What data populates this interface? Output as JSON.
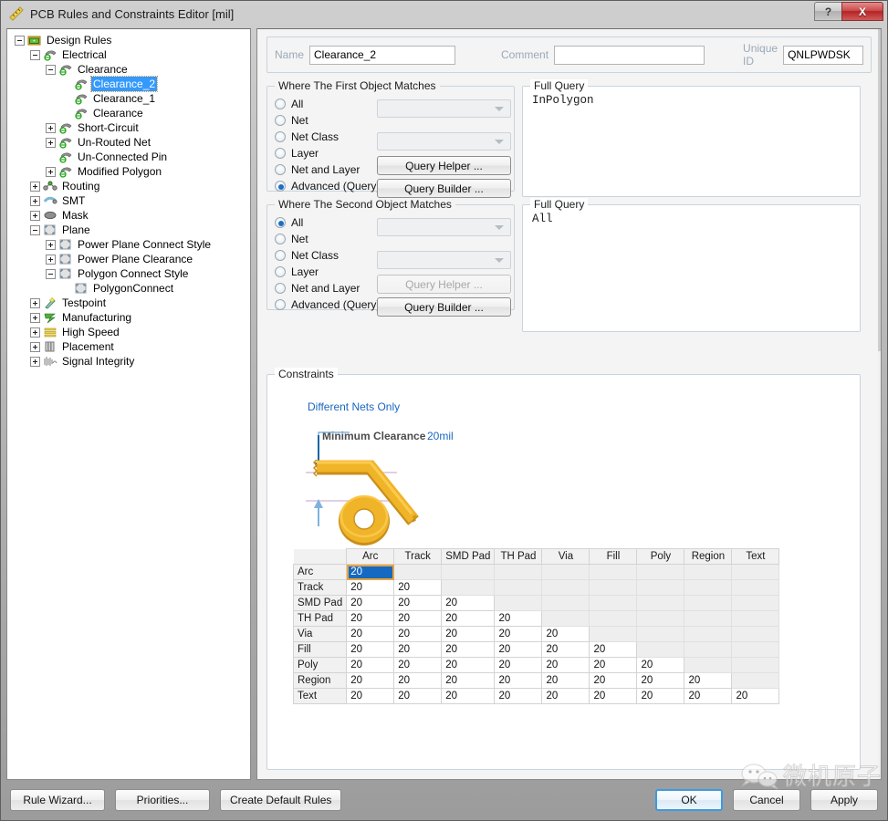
{
  "window": {
    "title": "PCB Rules and Constraints Editor [mil]",
    "app_icon": "ruler-icon",
    "help_button": "?",
    "close_button": "X"
  },
  "tree": {
    "items": [
      {
        "label": "Design Rules",
        "depth": 0,
        "state": "minus",
        "icon": "design-rules-folder-icon",
        "selected": false
      },
      {
        "label": "Electrical",
        "depth": 1,
        "state": "minus",
        "icon": "electrical-icon",
        "selected": false
      },
      {
        "label": "Clearance",
        "depth": 2,
        "state": "minus",
        "icon": "electrical-icon",
        "selected": false
      },
      {
        "label": "Clearance_2",
        "depth": 3,
        "state": "none",
        "icon": "electrical-icon",
        "selected": true
      },
      {
        "label": "Clearance_1",
        "depth": 3,
        "state": "none",
        "icon": "electrical-icon",
        "selected": false
      },
      {
        "label": "Clearance",
        "depth": 3,
        "state": "none",
        "icon": "electrical-icon",
        "selected": false
      },
      {
        "label": "Short-Circuit",
        "depth": 2,
        "state": "plus",
        "icon": "electrical-icon",
        "selected": false
      },
      {
        "label": "Un-Routed Net",
        "depth": 2,
        "state": "plus",
        "icon": "electrical-icon",
        "selected": false
      },
      {
        "label": "Un-Connected Pin",
        "depth": 2,
        "state": "none",
        "icon": "electrical-icon",
        "selected": false
      },
      {
        "label": "Modified Polygon",
        "depth": 2,
        "state": "plus",
        "icon": "electrical-icon",
        "selected": false
      },
      {
        "label": "Routing",
        "depth": 1,
        "state": "plus",
        "icon": "routing-icon",
        "selected": false
      },
      {
        "label": "SMT",
        "depth": 1,
        "state": "plus",
        "icon": "smt-icon",
        "selected": false
      },
      {
        "label": "Mask",
        "depth": 1,
        "state": "plus",
        "icon": "mask-icon",
        "selected": false
      },
      {
        "label": "Plane",
        "depth": 1,
        "state": "minus",
        "icon": "plane-icon",
        "selected": false
      },
      {
        "label": "Power Plane Connect Style",
        "depth": 2,
        "state": "plus",
        "icon": "plane-icon",
        "selected": false
      },
      {
        "label": "Power Plane Clearance",
        "depth": 2,
        "state": "plus",
        "icon": "plane-icon",
        "selected": false
      },
      {
        "label": "Polygon Connect Style",
        "depth": 2,
        "state": "minus",
        "icon": "plane-icon",
        "selected": false
      },
      {
        "label": "PolygonConnect",
        "depth": 3,
        "state": "none",
        "icon": "plane-icon",
        "selected": false
      },
      {
        "label": "Testpoint",
        "depth": 1,
        "state": "plus",
        "icon": "testpoint-icon",
        "selected": false
      },
      {
        "label": "Manufacturing",
        "depth": 1,
        "state": "plus",
        "icon": "manufacturing-icon",
        "selected": false
      },
      {
        "label": "High Speed",
        "depth": 1,
        "state": "plus",
        "icon": "high-speed-icon",
        "selected": false
      },
      {
        "label": "Placement",
        "depth": 1,
        "state": "plus",
        "icon": "placement-icon",
        "selected": false
      },
      {
        "label": "Signal Integrity",
        "depth": 1,
        "state": "plus",
        "icon": "signal-integrity-icon",
        "selected": false
      }
    ]
  },
  "header": {
    "name_label": "Name",
    "name_value": "Clearance_2",
    "comment_label": "Comment",
    "comment_value": "",
    "comment_placeholder": "",
    "unique_id_label": "Unique ID",
    "unique_id_value": "QNLPWDSK"
  },
  "first_object": {
    "title": "Where The First Object Matches",
    "options": [
      {
        "label": "All",
        "selected": false
      },
      {
        "label": "Net",
        "selected": false
      },
      {
        "label": "Net Class",
        "selected": false
      },
      {
        "label": "Layer",
        "selected": false
      },
      {
        "label": "Net and Layer",
        "selected": false
      },
      {
        "label": "Advanced (Query)",
        "selected": true
      }
    ],
    "net_combo_value": "",
    "netclass_combo_value": "",
    "query_helper_label": "Query Helper ...",
    "query_builder_label": "Query Builder ...",
    "query_helper_disabled": false,
    "query_builder_disabled": false,
    "full_query_title": "Full Query",
    "full_query_text": "InPolygon"
  },
  "second_object": {
    "title": "Where The Second Object Matches",
    "options": [
      {
        "label": "All",
        "selected": true
      },
      {
        "label": "Net",
        "selected": false
      },
      {
        "label": "Net Class",
        "selected": false
      },
      {
        "label": "Layer",
        "selected": false
      },
      {
        "label": "Net and Layer",
        "selected": false
      },
      {
        "label": "Advanced (Query)",
        "selected": false
      }
    ],
    "net_combo_value": "",
    "netclass_combo_value": "",
    "query_helper_label": "Query Helper ...",
    "query_builder_label": "Query Builder ...",
    "query_helper_disabled": true,
    "query_builder_disabled": false,
    "full_query_title": "Full Query",
    "full_query_text": "All"
  },
  "constraints": {
    "title": "Constraints",
    "different_nets_only": "Different Nets Only",
    "minimum_clearance_label": "Minimum Clearance",
    "minimum_clearance_value": "20mil",
    "accent_link_color": "#1a66c0",
    "track_color": "#f0b429",
    "matrix": {
      "columns": [
        "Arc",
        "Track",
        "SMD Pad",
        "TH Pad",
        "Via",
        "Fill",
        "Poly",
        "Region",
        "Text"
      ],
      "rows": [
        {
          "header": "Arc",
          "values": [
            "20"
          ]
        },
        {
          "header": "Track",
          "values": [
            "20",
            "20"
          ]
        },
        {
          "header": "SMD Pad",
          "values": [
            "20",
            "20",
            "20"
          ]
        },
        {
          "header": "TH Pad",
          "values": [
            "20",
            "20",
            "20",
            "20"
          ]
        },
        {
          "header": "Via",
          "values": [
            "20",
            "20",
            "20",
            "20",
            "20"
          ]
        },
        {
          "header": "Fill",
          "values": [
            "20",
            "20",
            "20",
            "20",
            "20",
            "20"
          ]
        },
        {
          "header": "Poly",
          "values": [
            "20",
            "20",
            "20",
            "20",
            "20",
            "20",
            "20"
          ]
        },
        {
          "header": "Region",
          "values": [
            "20",
            "20",
            "20",
            "20",
            "20",
            "20",
            "20",
            "20"
          ]
        },
        {
          "header": "Text",
          "values": [
            "20",
            "20",
            "20",
            "20",
            "20",
            "20",
            "20",
            "20",
            "20"
          ]
        }
      ],
      "selected_cell": {
        "row": 0,
        "col": 0
      }
    }
  },
  "footer": {
    "rule_wizard": "Rule Wizard...",
    "priorities": "Priorities...",
    "create_default_rules": "Create Default Rules",
    "ok": "OK",
    "cancel": "Cancel",
    "apply": "Apply"
  },
  "watermark": {
    "text": "微机原子",
    "icon": "wechat-bubble-icon"
  }
}
